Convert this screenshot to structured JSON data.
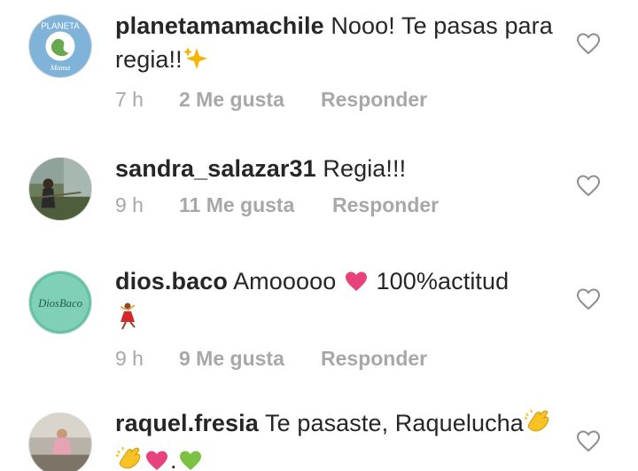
{
  "comments": [
    {
      "username": "planetamamachile",
      "text": "Nooo! Te pasas para regia!!",
      "time": "7 h",
      "likes": "2 Me gusta",
      "reply": "Responder",
      "avatar_text_top": "PLANETA",
      "avatar_text_bottom": "Mama",
      "emoji": [
        "sparkles-icon"
      ]
    },
    {
      "username": "sandra_salazar31",
      "text": "Regia!!!",
      "time": "9 h",
      "likes": "11 Me gusta",
      "reply": "Responder"
    },
    {
      "username": "dios.baco",
      "text_before": "Amooooo",
      "text_after": "100%actitud",
      "time": "9 h",
      "likes": "9 Me gusta",
      "reply": "Responder",
      "avatar_text": "DiosBaco",
      "emoji": [
        "pink-heart-icon",
        "dancer-icon"
      ]
    },
    {
      "username": "raquel.fresia",
      "text": "Te pasaste, Raquelucha",
      "text_dot": ".",
      "emoji": [
        "clapping-hands-icon",
        "clapping-hands-icon",
        "pink-heart-icon",
        "green-heart-icon"
      ]
    }
  ],
  "colors": {
    "username": "#262626",
    "meta": "#a8a8a8",
    "pink_heart": "#e8427d",
    "green_heart": "#7cc242",
    "sparkle": "#f4b400",
    "clap": "#f7c223"
  }
}
